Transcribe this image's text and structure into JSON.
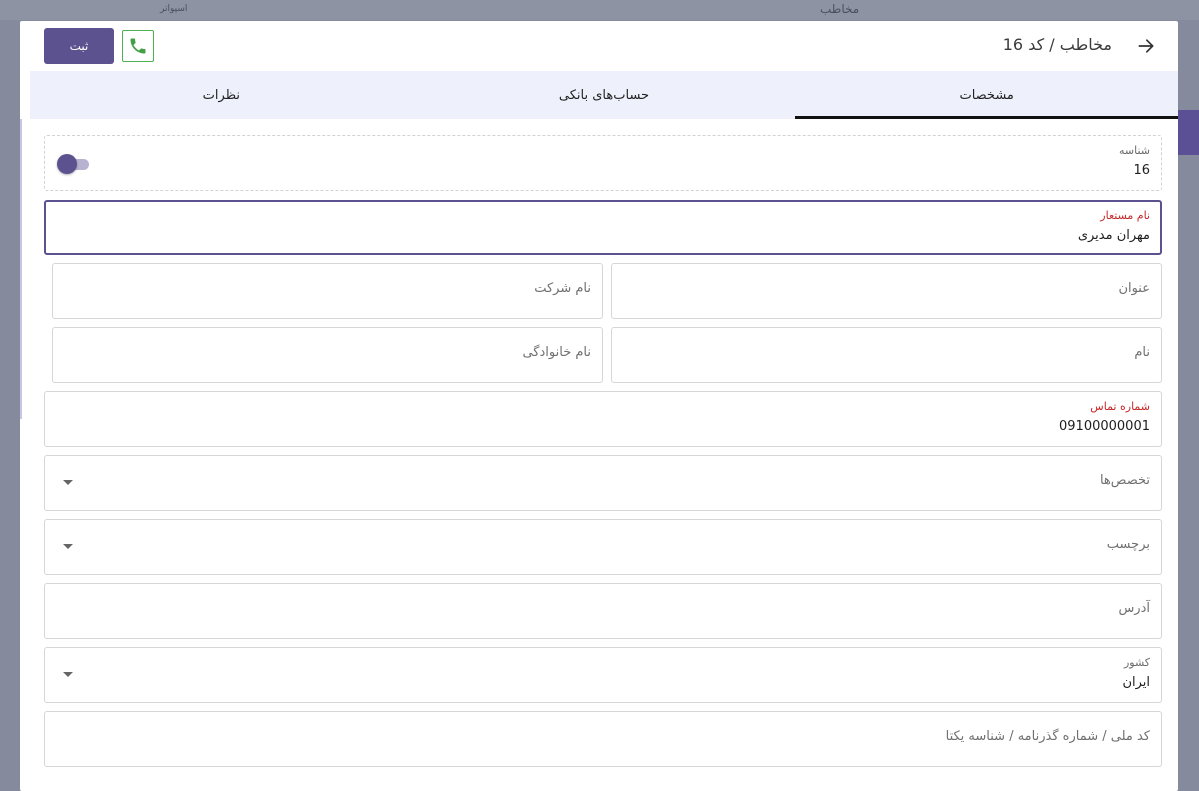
{
  "background": {
    "top_text_1": "اسپواتر",
    "top_text_2": "مخاطب"
  },
  "modal": {
    "title": "مخاطب / کد 16",
    "submit_label": "ثبت",
    "call_icon": "phone-icon",
    "back_icon": "arrow-right-icon"
  },
  "tabs": [
    {
      "label": "مشخصات",
      "active": true
    },
    {
      "label": "حساب‌های بانکی",
      "active": false
    },
    {
      "label": "نظرات",
      "active": false
    }
  ],
  "form": {
    "id": {
      "label": "شناسه",
      "value": "16"
    },
    "alias": {
      "label": "نام مستعار",
      "value": "مهران مدیری"
    },
    "title_field": {
      "placeholder": "عنوان"
    },
    "company": {
      "placeholder": "نام شرکت"
    },
    "first_name": {
      "placeholder": "نام"
    },
    "last_name": {
      "placeholder": "نام خانوادگی"
    },
    "phone": {
      "label": "شماره تماس",
      "value": "09100000001"
    },
    "specialties": {
      "placeholder": "تخصص‌ها"
    },
    "tag": {
      "placeholder": "برچسب"
    },
    "address": {
      "placeholder": "آدرس"
    },
    "country": {
      "label": "کشور",
      "value": "ایران"
    },
    "national_id": {
      "placeholder": "کد ملی / شماره گذرنامه / شناسه یکتا"
    }
  },
  "colors": {
    "accent": "#5c528f",
    "tab_bar": "#eef1fb",
    "required_label": "#c62828",
    "call_green": "#4caf50"
  }
}
